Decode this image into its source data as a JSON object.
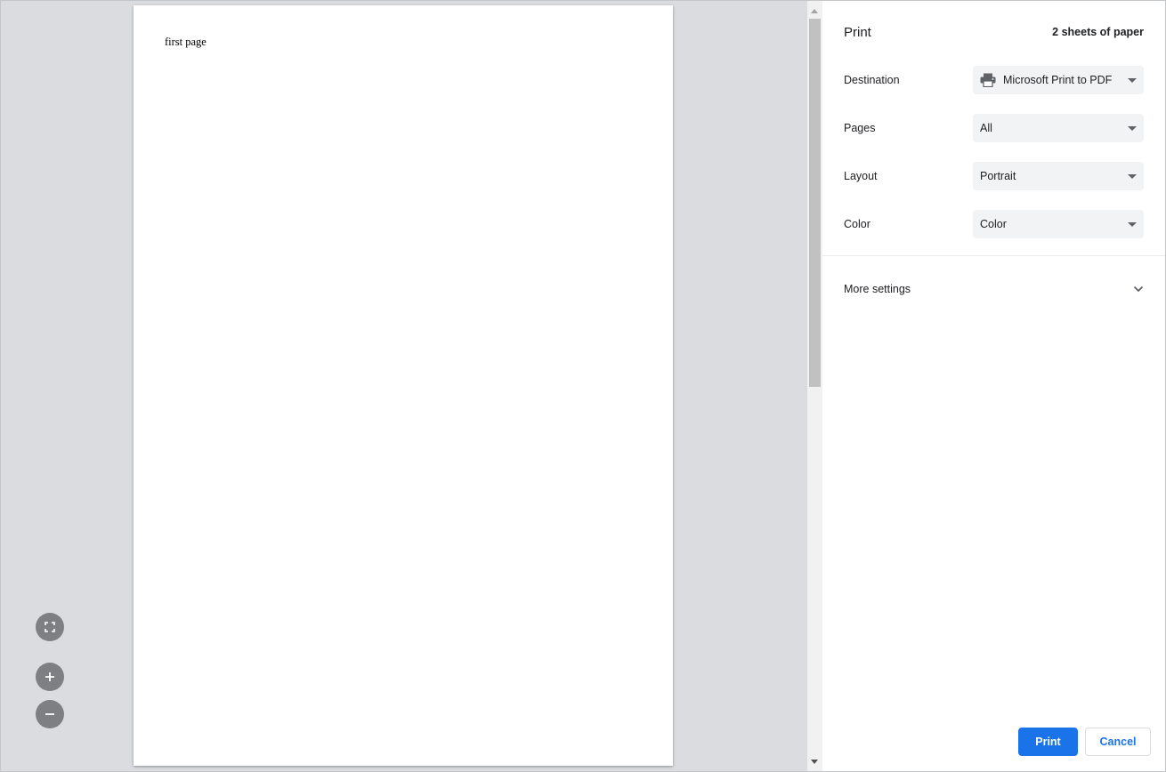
{
  "preview": {
    "page_text": "first page",
    "zoom_controls": {
      "fit_icon": "fit-to-page-icon",
      "zoom_in_icon": "plus-icon",
      "zoom_out_icon": "minus-icon"
    }
  },
  "sidebar": {
    "title": "Print",
    "sheets": "2 sheets of paper",
    "destination": {
      "label": "Destination",
      "value": "Microsoft Print to PDF",
      "icon": "printer-icon"
    },
    "pages": {
      "label": "Pages",
      "value": "All"
    },
    "layout": {
      "label": "Layout",
      "value": "Portrait"
    },
    "color": {
      "label": "Color",
      "value": "Color"
    },
    "more_settings": {
      "label": "More settings",
      "icon": "chevron-down-icon"
    }
  },
  "footer": {
    "print_label": "Print",
    "cancel_label": "Cancel"
  },
  "colors": {
    "accent": "#1a73e8",
    "preview_background": "#dadce0",
    "select_background": "#f1f3f4",
    "zoom_button": "#7d7f82"
  }
}
